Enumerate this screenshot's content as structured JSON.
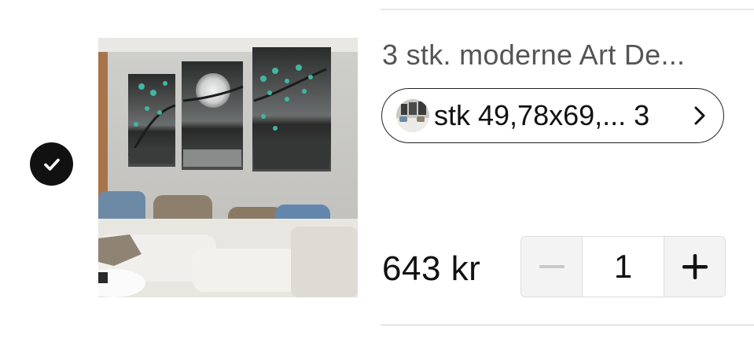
{
  "cart_item": {
    "selected": true,
    "title": "3 stk. moderne Art De...",
    "variant": {
      "label": "stk 49,78x69,... 3"
    },
    "price": "643 kr",
    "quantity": {
      "value": "1",
      "decrement_icon": "minus-icon",
      "increment_icon": "plus-icon"
    }
  },
  "colors": {
    "checkbox_bg": "#111111",
    "divider": "#e6e6e6",
    "stepper_button_bg": "#f3f3f3",
    "minus_disabled": "#c8c8c8"
  },
  "icons": {
    "checkbox": "check-icon",
    "variant_chevron": "chevron-right-icon"
  }
}
